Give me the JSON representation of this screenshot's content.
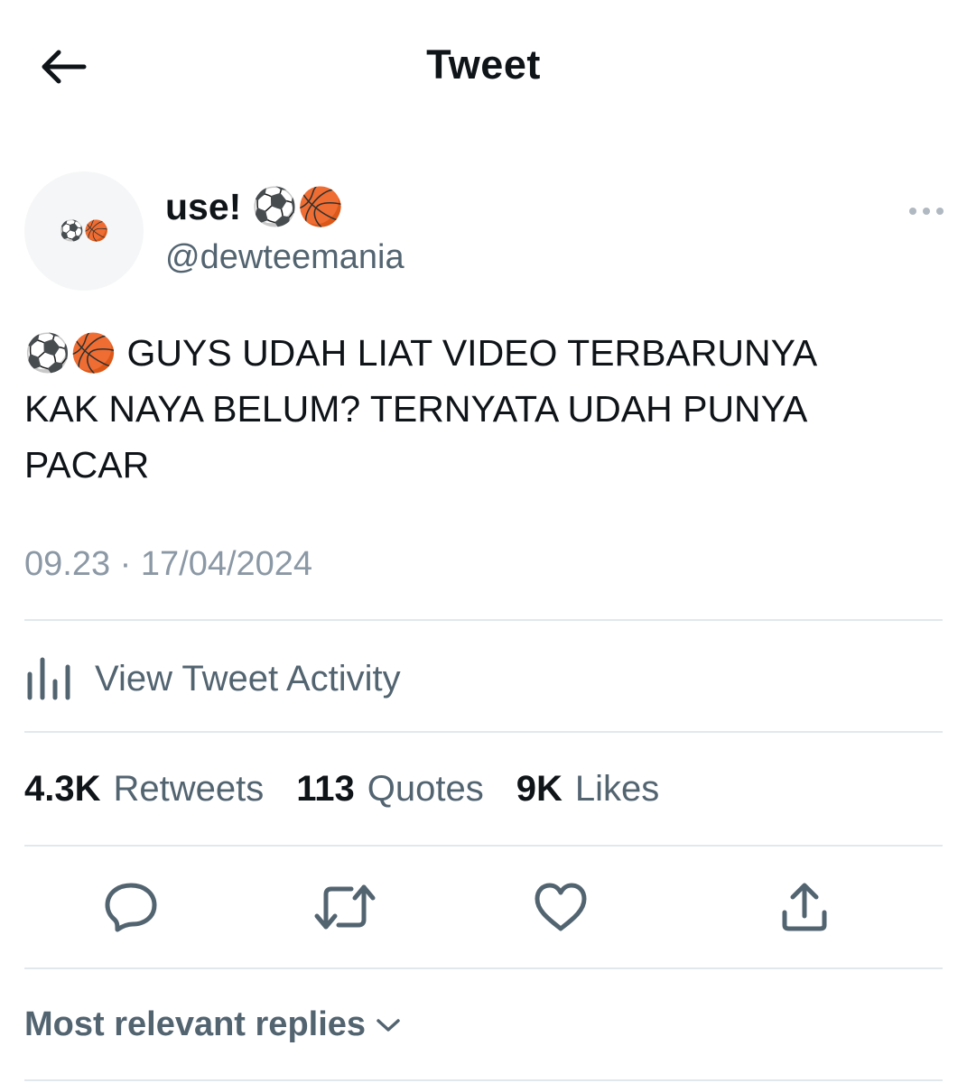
{
  "header": {
    "title": "Tweet"
  },
  "author": {
    "display_name": "use! ⚽🏀",
    "handle": "@dewteemania",
    "avatar_emoji": "⚽🏀"
  },
  "tweet": {
    "text": "⚽🏀 GUYS UDAH LIAT VIDEO TERBARUNYA\nKAK NAYA BELUM? TERNYATA UDAH PUNYA\nPACAR",
    "timestamp": "09.23 · 17/04/2024"
  },
  "activity": {
    "label": "View Tweet Activity"
  },
  "stats": [
    {
      "count": "4.3K",
      "label": "Retweets"
    },
    {
      "count": "113",
      "label": "Quotes"
    },
    {
      "count": "9K",
      "label": "Likes"
    }
  ],
  "actions": {
    "icons": [
      "reply-icon",
      "retweet-icon",
      "like-icon",
      "share-icon"
    ]
  },
  "replies": {
    "sort_label": "Most relevant replies"
  },
  "colors": {
    "text_primary": "#0f1419",
    "text_secondary": "#536471",
    "timestamp": "#8b98a5",
    "divider": "#e1e8ed"
  }
}
